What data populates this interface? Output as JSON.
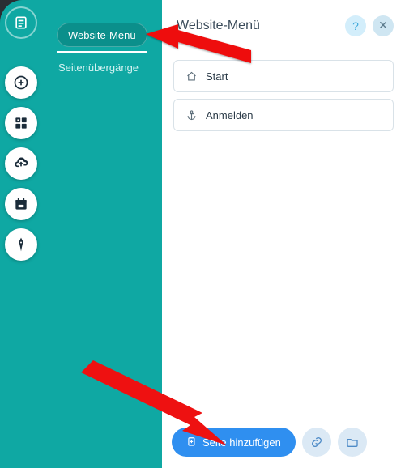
{
  "menu": {
    "tabs": {
      "website_menu": "Website-Menü",
      "page_transitions": "Seitenübergänge"
    }
  },
  "panel": {
    "title": "Website-Menü",
    "help_label": "?",
    "close_label": "✕",
    "pages": [
      {
        "label": "Start",
        "icon": "home-icon"
      },
      {
        "label": "Anmelden",
        "icon": "anchor-icon"
      }
    ],
    "footer": {
      "add_page_label": "Seite hinzufügen"
    }
  }
}
